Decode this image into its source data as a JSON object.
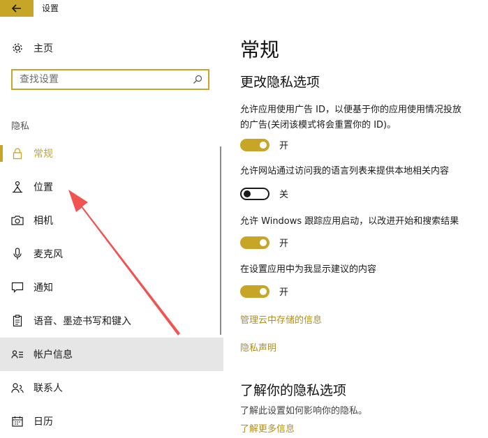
{
  "window": {
    "title": "设置",
    "back_icon": "back-arrow-icon"
  },
  "sidebar": {
    "home_label": "主页",
    "search_placeholder": "查找设置",
    "section_label": "隐私",
    "items": [
      {
        "label": "常规",
        "icon": "lock-icon",
        "active": true
      },
      {
        "label": "位置",
        "icon": "location-icon"
      },
      {
        "label": "相机",
        "icon": "camera-icon"
      },
      {
        "label": "麦克风",
        "icon": "microphone-icon"
      },
      {
        "label": "通知",
        "icon": "notification-icon"
      },
      {
        "label": "语音、墨迹书写和键入",
        "icon": "clipboard-icon"
      },
      {
        "label": "帐户信息",
        "icon": "account-info-icon",
        "highlighted": true
      },
      {
        "label": "联系人",
        "icon": "contacts-icon"
      },
      {
        "label": "日历",
        "icon": "calendar-icon"
      }
    ]
  },
  "main": {
    "title": "常规",
    "subtitle": "更改隐私选项",
    "settings": [
      {
        "desc_line1": "允许应用使用广告 ID，以便基于你的应用使用情况投放",
        "desc_line2": "的广告(关闭该模式将会重置你的 ID)。",
        "state": "开",
        "on": true
      },
      {
        "desc_line1": "允许网站通过访问我的语言列表来提供本地相关内容",
        "state": "关",
        "on": false
      },
      {
        "desc_line1": "允许 Windows 跟踪应用启动，以改进开始和搜索结果",
        "state": "开",
        "on": true
      },
      {
        "desc_line1": "在设置应用中为我显示建议的内容",
        "state": "开",
        "on": true
      }
    ],
    "link_cloud": "管理云中存储的信息",
    "link_privacy": "隐私声明",
    "learn_title": "了解你的隐私选项",
    "learn_desc": "了解此设置如何影响你的隐私。",
    "learn_link": "了解更多信息"
  },
  "colors": {
    "accent": "#c7a527",
    "link": "#b28f1e",
    "highlight": "#e6e6e6",
    "annotation": "#f04a4a"
  }
}
